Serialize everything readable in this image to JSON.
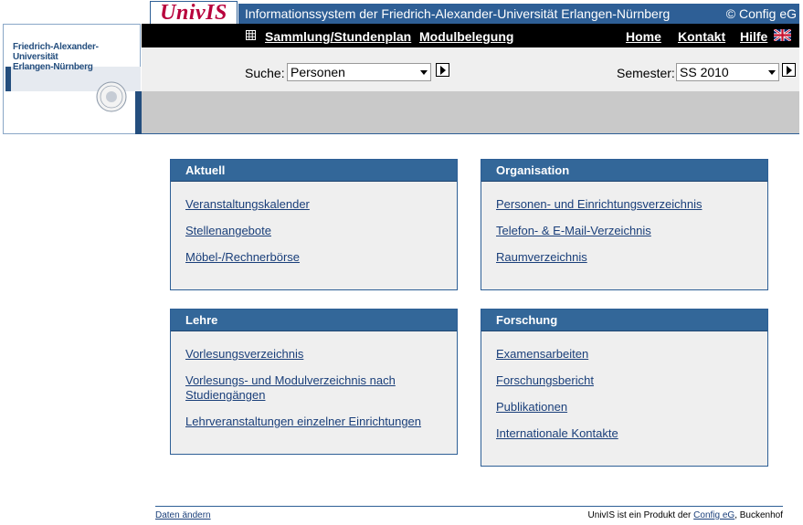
{
  "header": {
    "logo": "UnivIS",
    "title": "Informationssystem der Friedrich-Alexander-Universität Erlangen-Nürnberg",
    "copyright": "© Config eG",
    "university": [
      "Friedrich-Alexander-Universität",
      "Erlangen-Nürnberg"
    ]
  },
  "nav": {
    "sammlung": "Sammlung/Stundenplan",
    "modul": "Modulbelegung",
    "home": "Home",
    "kontakt": "Kontakt",
    "hilfe": "Hilfe"
  },
  "search": {
    "label": "Suche:",
    "value": "Personen",
    "semester_label": "Semester:",
    "semester_value": "SS 2010"
  },
  "boxes": {
    "aktuell": {
      "title": "Aktuell",
      "links": [
        "Veranstaltungskalender",
        "Stellenangebote",
        "Möbel-/Rechnerbörse"
      ]
    },
    "organisation": {
      "title": "Organisation",
      "links": [
        "Personen- und Einrichtungsverzeichnis",
        "Telefon- & E-Mail-Verzeichnis",
        "Raumverzeichnis"
      ]
    },
    "lehre": {
      "title": "Lehre",
      "links": [
        "Vorlesungsverzeichnis",
        "Vorlesungs- und Modulverzeichnis nach Studiengängen",
        "Lehrveranstaltungen einzelner Einrichtungen"
      ]
    },
    "forschung": {
      "title": "Forschung",
      "links": [
        "Examensarbeiten",
        "Forschungsbericht",
        "Publikationen",
        "Internationale Kontakte"
      ]
    }
  },
  "footer": {
    "change": "Daten ändern",
    "product_prefix": "UnivIS ist ein Produkt der ",
    "company": "Config eG",
    "product_suffix": ", Buckenhof"
  },
  "colors": {
    "accent": "#336799",
    "link": "#1a3f7a",
    "logo": "#b8003c"
  }
}
